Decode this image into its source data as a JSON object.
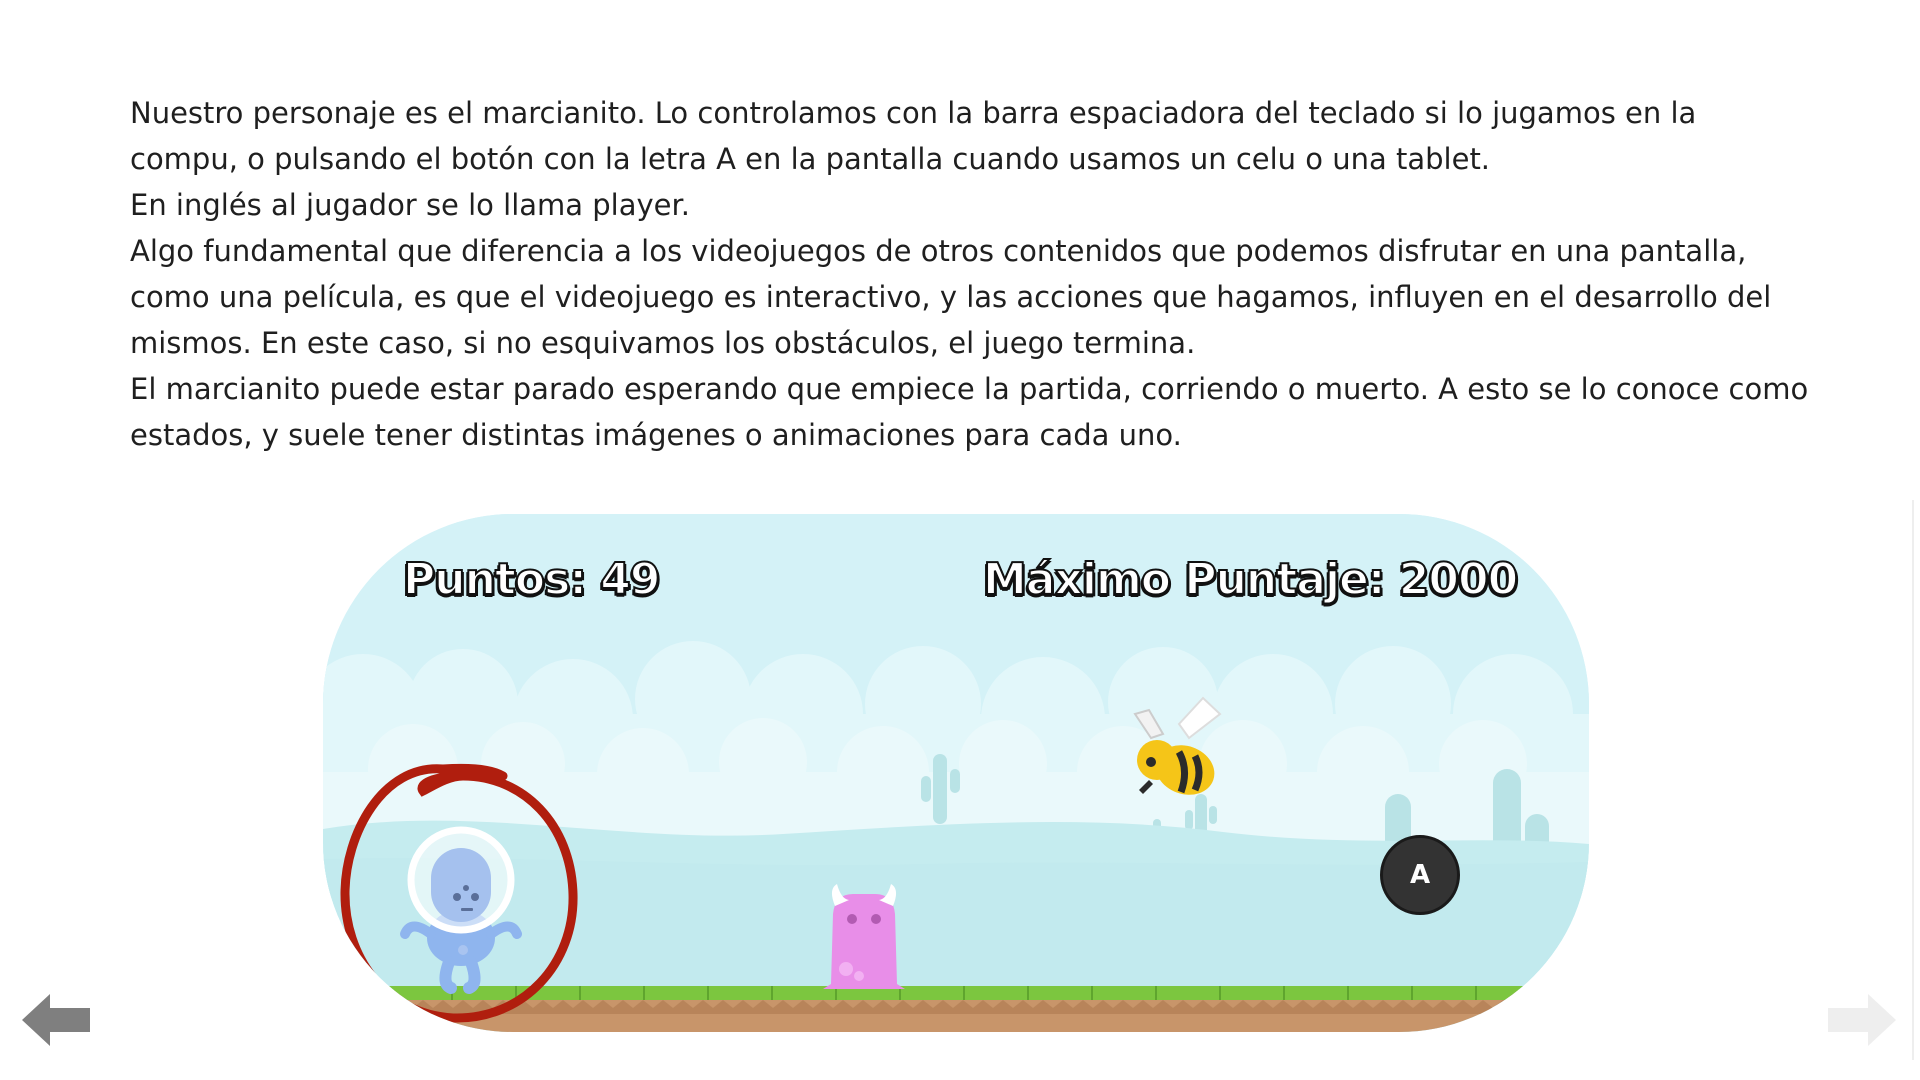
{
  "paragraphs": [
    "Nuestro personaje es el marcianito. Lo controlamos con la barra espaciadora del teclado si lo jugamos en la compu, o pulsando el botón con la letra A en la pantalla cuando usamos un celu o una tablet.",
    "En inglés al jugador se lo llama player.",
    "Algo fundamental que diferencia a los videojuegos de otros contenidos que podemos disfrutar en una pantalla, como una película, es que el videojuego es interactivo, y las acciones que hagamos, influyen en el desarrollo del mismos. En este caso, si no esquivamos los obstáculos, el juego termina.",
    "El marcianito puede estar parado esperando que empiece la partida, corriendo o muerto. A esto se lo conoce como estados, y suele tener distintas imágenes o animaciones para cada uno."
  ],
  "game": {
    "score_text": "Puntos: 49",
    "high_score_text": "Máximo Puntaje: 2000",
    "action_button_label": "A"
  },
  "icons": {
    "prev": "arrow-left-icon",
    "next": "arrow-right-icon"
  },
  "colors": {
    "sky": "#d4f2f7",
    "ground_grass": "#7cc63f",
    "ground_dirt": "#c8956a",
    "highlight_circle": "#b01e0e",
    "player": "#8fb5ee",
    "monster": "#e88ee8",
    "bee": "#f5c518",
    "nav_active": "#7f7f7f",
    "nav_disabled": "#eeeeee"
  }
}
